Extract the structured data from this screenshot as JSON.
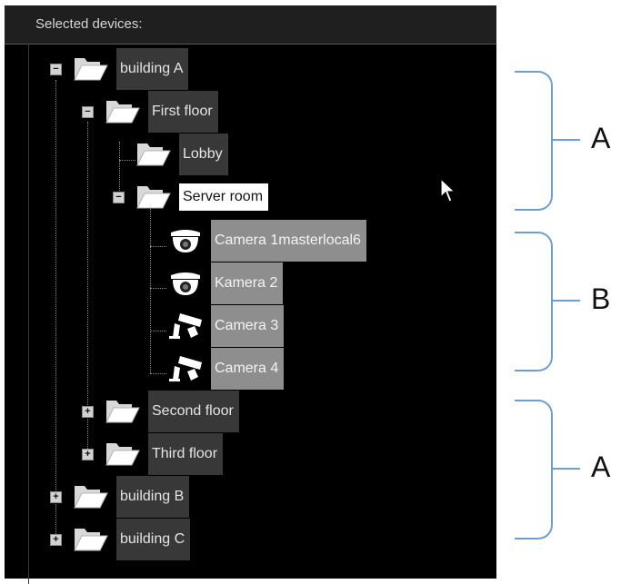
{
  "panel": {
    "title": "Selected devices:"
  },
  "tree": {
    "building_a": "building A",
    "first_floor": "First floor",
    "lobby": "Lobby",
    "server_room": "Server room",
    "camera1": "Camera 1masterlocal6",
    "kamera2": "Kamera 2",
    "camera3": "Camera 3",
    "camera4": "Camera 4",
    "second_floor": "Second floor",
    "third_floor": "Third floor",
    "building_b": "building B",
    "building_c": "building C"
  },
  "toggles": {
    "expanded": "−",
    "collapsed": "+"
  },
  "annotations": [
    {
      "label": "A"
    },
    {
      "label": "B"
    },
    {
      "label": "A"
    }
  ],
  "icons": {
    "folder": "folder-icon",
    "dome_camera": "dome-camera-icon",
    "bullet_camera": "bullet-camera-icon",
    "cursor": "mouse-cursor-icon"
  },
  "colors": {
    "panel_bg": "#000000",
    "header_bg": "#1f1f1f",
    "label_dark": "#383838",
    "label_mid": "#8e8e8e",
    "label_selected": "#ffffff",
    "bracket": "#6d9ed8"
  }
}
